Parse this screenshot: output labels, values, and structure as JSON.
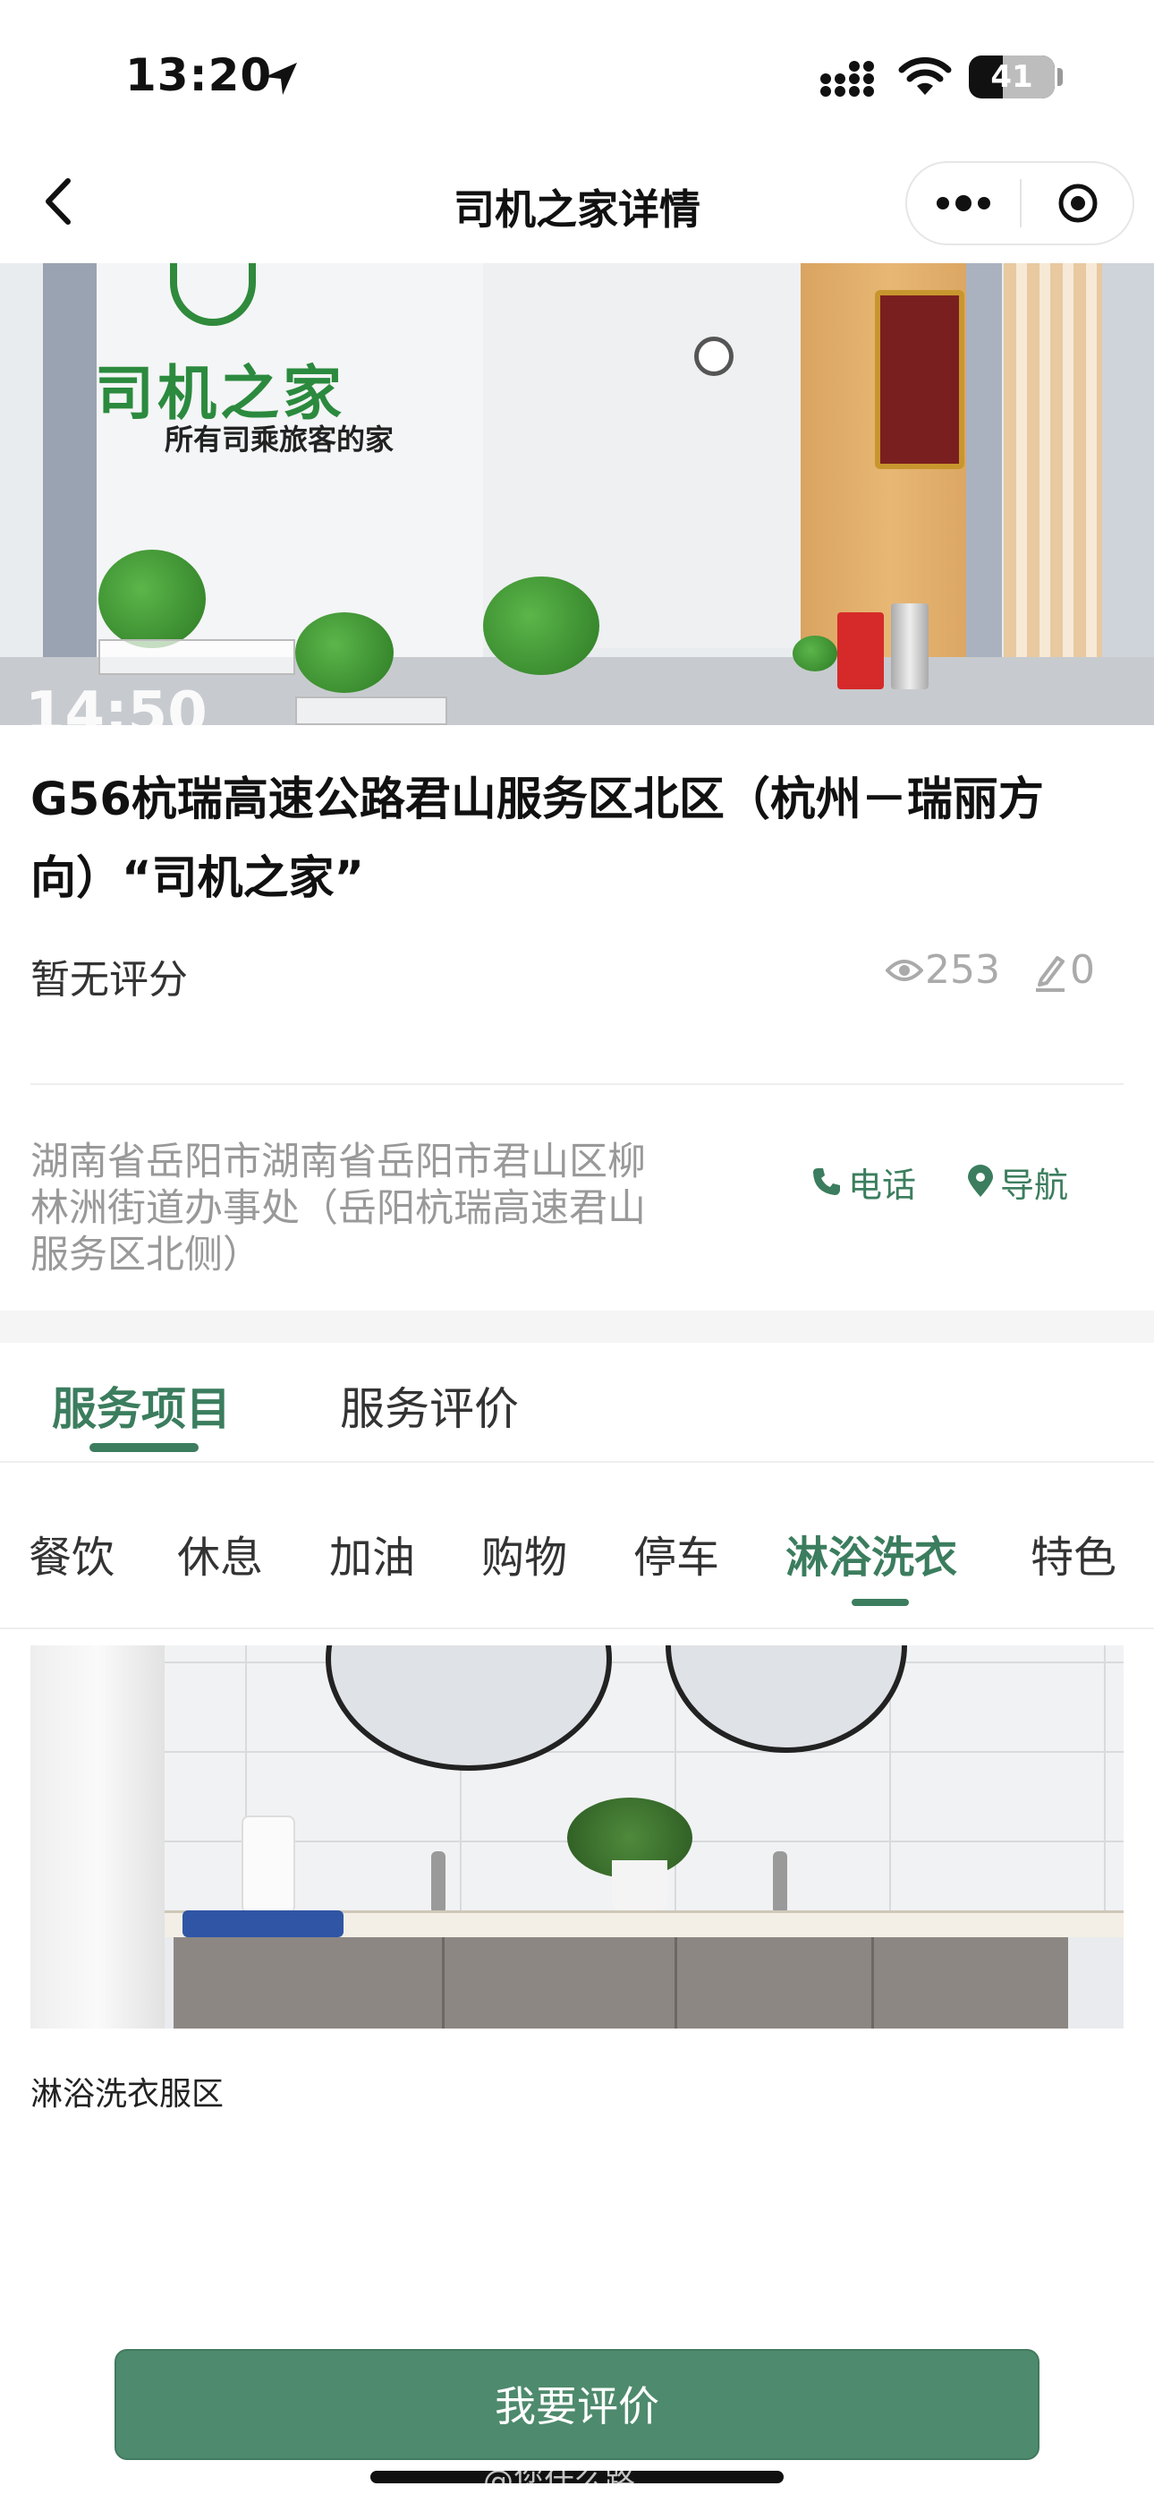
{
  "status_bar": {
    "time": "13:20",
    "battery": "41"
  },
  "nav": {
    "title": "司机之家详情"
  },
  "hero": {
    "sign_main": "司机之家",
    "sign_sub": "所有司乘旅客的家",
    "overlay_text": "14:50",
    "dots_count": 7,
    "active_dot": 1
  },
  "place": {
    "title": "G56杭瑞高速公路君山服务区北区（杭州－瑞丽方向）“司机之家”",
    "rating": "暂无评分",
    "views": "253",
    "edits": "0",
    "address": "湖南省岳阳市湖南省岳阳市君山区柳林洲街道办事处（岳阳杭瑞高速君山服务区北侧）",
    "phone_label": "电话",
    "navigate_label": "导航"
  },
  "tabs": {
    "service": "服务项目",
    "review": "服务评价"
  },
  "categories": [
    "餐饮",
    "休息",
    "加油",
    "购物",
    "停车",
    "淋浴洗衣",
    "特色"
  ],
  "active_category": "淋浴洗衣",
  "content": {
    "caption": "淋浴洗衣服区"
  },
  "bottom": {
    "button_label": "我要评价",
    "watermark": "@您什么路"
  },
  "colors": {
    "accent": "#3b7d5e",
    "button": "#4e8a6d"
  }
}
